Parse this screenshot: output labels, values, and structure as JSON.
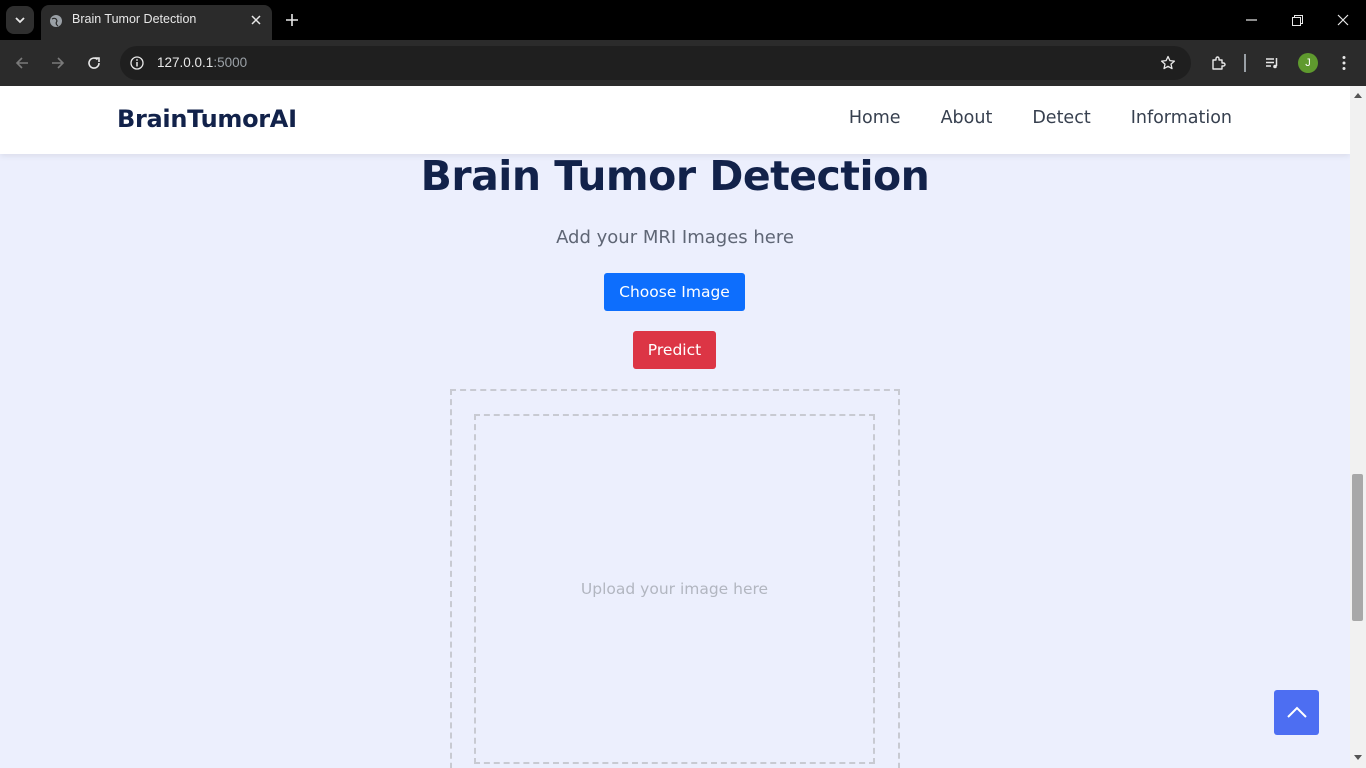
{
  "browser": {
    "tab_title": "Brain Tumor Detection",
    "url_host": "127.0.0.1",
    "url_port": ":5000",
    "profile_initial": "J",
    "icons": [
      "tab-search-icon",
      "globe-icon",
      "close-icon",
      "plus-icon",
      "minimize-icon",
      "restore-icon",
      "back-arrow-icon",
      "forward-arrow-icon",
      "reload-icon",
      "info-icon",
      "star-icon",
      "extensions-icon",
      "media-controls-icon",
      "kebab-menu-icon"
    ]
  },
  "header": {
    "brand": "BrainTumorAI",
    "nav": [
      "Home",
      "About",
      "Detect",
      "Information"
    ]
  },
  "main": {
    "title": "Brain Tumor Detection",
    "subtitle": "Add your MRI Images here",
    "choose_label": "Choose Image",
    "predict_label": "Predict",
    "upload_placeholder": "Upload your image here"
  },
  "colors": {
    "page_bg": "#eceffd",
    "brand_navy": "#12224a",
    "choose_blue": "#0d6efd",
    "predict_red": "#dc3545",
    "back_to_top": "#4d6ef2"
  }
}
